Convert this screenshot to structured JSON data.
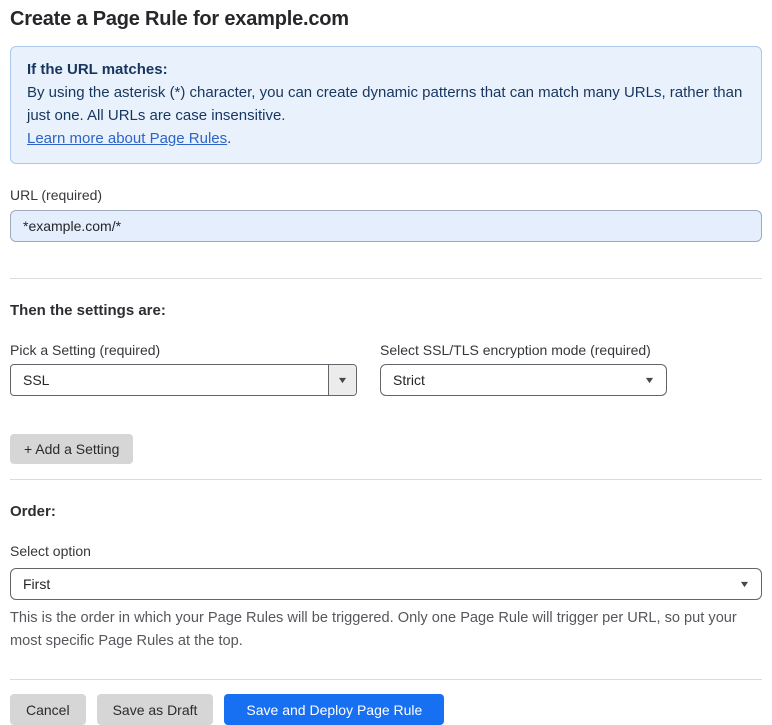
{
  "page": {
    "title": "Create a Page Rule for example.com"
  },
  "info_box": {
    "heading": "If the URL matches:",
    "body": "By using the asterisk (*) character, you can create dynamic patterns that can match many URLs, rather than just one. All URLs are case insensitive.",
    "link_label": "Learn more about Page Rules",
    "link_suffix": "."
  },
  "url_field": {
    "label": "URL (required)",
    "value": "*example.com/*"
  },
  "settings_section": {
    "heading": "Then the settings are:",
    "setting_select": {
      "label": "Pick a Setting (required)",
      "value": "SSL"
    },
    "mode_select": {
      "label": "Select SSL/TLS encryption mode (required)",
      "value": "Strict"
    },
    "add_setting_label": "+ Add a Setting"
  },
  "order_section": {
    "heading": "Order:",
    "select_label": "Select option",
    "select_value": "First",
    "help_text": "This is the order in which your Page Rules will be triggered. Only one Page Rule will trigger per URL, so put your most specific Page Rules at the top."
  },
  "footer": {
    "cancel_label": "Cancel",
    "save_draft_label": "Save as Draft",
    "save_deploy_label": "Save and Deploy Page Rule"
  },
  "icons": {
    "dropdown_arrow": "▼"
  },
  "colors": {
    "accent_blue": "#176ff2",
    "info_background": "#e9f2fc",
    "info_border": "#a9c9ed",
    "info_text": "#17365f",
    "link_blue": "#2d64c8",
    "filled_input_background": "#e4eefc",
    "gray_button": "#d6d6d6"
  }
}
